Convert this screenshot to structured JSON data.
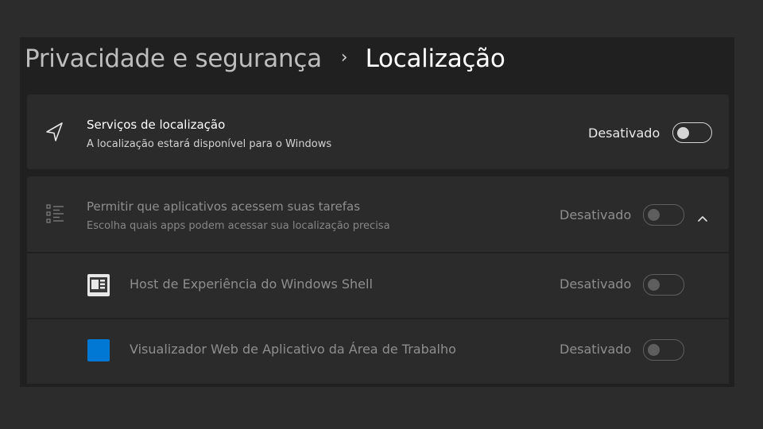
{
  "breadcrumb": {
    "parent": "Privacidade e segurança",
    "separator": "›",
    "current": "Localização"
  },
  "location_services": {
    "icon": "navigation-arrow-icon",
    "title": "Serviços de localização",
    "subtitle": "A localização estará disponível para o Windows",
    "status": "Desativado",
    "enabled": false
  },
  "apps_access": {
    "icon": "list-icon",
    "title": "Permitir que aplicativos acessem suas tarefas",
    "subtitle": "Escolha quais apps podem acessar sua localização precisa",
    "status": "Desativado",
    "enabled": false,
    "expanded": true,
    "apps": [
      {
        "icon": "windows-shell-app-icon",
        "name": "Host de Experiência do Windows Shell",
        "status": "Desativado",
        "enabled": false
      },
      {
        "icon": "blue-tile-app-icon",
        "name": "Visualizador Web de Aplicativo da Área de Trabalho",
        "status": "Desativado",
        "enabled": false,
        "icon_color": "#0078d4"
      }
    ]
  },
  "colors": {
    "window_bg": "#202020",
    "card_bg": "#2b2b2b",
    "outer_bg": "#2c2c2c",
    "accent_blue": "#0078d4"
  }
}
